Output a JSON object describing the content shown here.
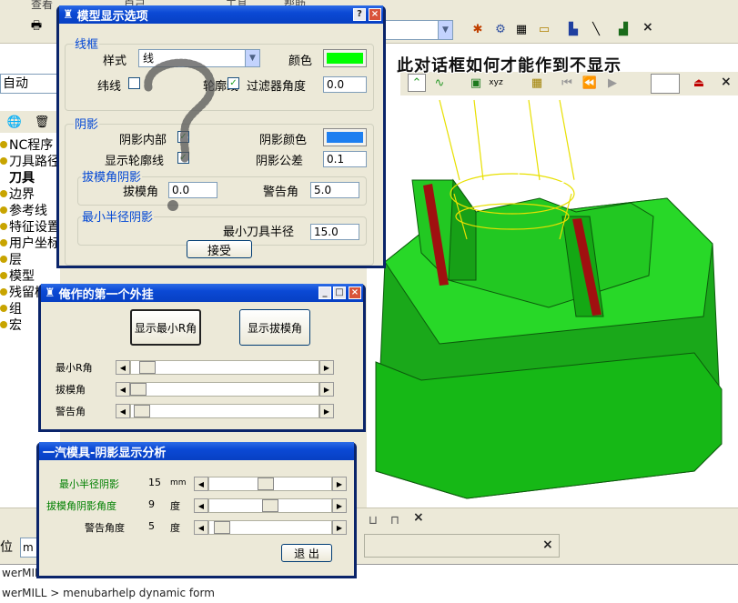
{
  "app": {
    "menu": [
      "查看",
      "自己",
      "工具",
      "帮助"
    ],
    "cmd_lines": [
      "werMILL >",
      "werMILL >  menubarhelp dynamic form"
    ],
    "left_combo_value": "自动",
    "bottom_label": "位",
    "bottom_combo_value": "m"
  },
  "tree": {
    "items": [
      "NC程序",
      "刀具路径",
      "刀具",
      "边界",
      "参考线",
      "特征设置",
      "用户坐标系",
      "层",
      "模型",
      "残留模型",
      "组",
      "宏"
    ]
  },
  "caption": "此对话框如何才能作到不显示",
  "model_dialog": {
    "title": "模型显示选项",
    "help_btn": "?",
    "close_btn": "×",
    "wireframe": {
      "group_label": "线框",
      "style_label": "样式",
      "style_value": "线",
      "color_label": "颜色",
      "color": "#00ff00",
      "latitude_label": "纬线",
      "contour_label": "轮廓线",
      "filter_angle_label": "过滤器角度",
      "filter_angle_value": "0.0"
    },
    "shading": {
      "group_label": "阴影",
      "inside_label": "阴影内部",
      "outline_label": "显示轮廓线",
      "shade_color_label": "阴影颜色",
      "shade_color": "#1e7ff0",
      "tolerance_label": "阴影公差",
      "tolerance_value": "0.1"
    },
    "draft": {
      "group_label": "拔模角阴影",
      "angle_label": "拔模角",
      "angle_value": "0.0",
      "warn_label": "警告角",
      "warn_value": "5.0"
    },
    "min_radius": {
      "group_label": "最小半径阴影",
      "label": "最小刀具半径",
      "value": "15.0"
    },
    "accept_btn": "接受"
  },
  "plugin_dialog": {
    "title": "俺作的第一个外挂",
    "btn_min_r": "显示最小R角",
    "btn_draft": "显示拔模角",
    "rows": [
      {
        "label": "最小R角",
        "pos": 0.05
      },
      {
        "label": "拔模角",
        "pos": 0.0
      },
      {
        "label": "警告角",
        "pos": 0.02
      }
    ]
  },
  "shade_dialog": {
    "title": "一汽模具-阴影显示分析",
    "rows": [
      {
        "label": "最小半径阴影",
        "value": "15",
        "unit": "mm",
        "pos": 0.46,
        "color": "#008000"
      },
      {
        "label": "拔模角阴影角度",
        "value": "9",
        "unit": "度",
        "pos": 0.5,
        "color": "#008000"
      },
      {
        "label": "警告角度",
        "value": "5",
        "unit": "度",
        "pos": 0.05,
        "color": "#000000"
      }
    ],
    "exit_btn": "退  出"
  },
  "colors": {
    "model_green": "#1ed21e",
    "model_red": "#a01010",
    "wire_yellow": "#e8e000"
  }
}
